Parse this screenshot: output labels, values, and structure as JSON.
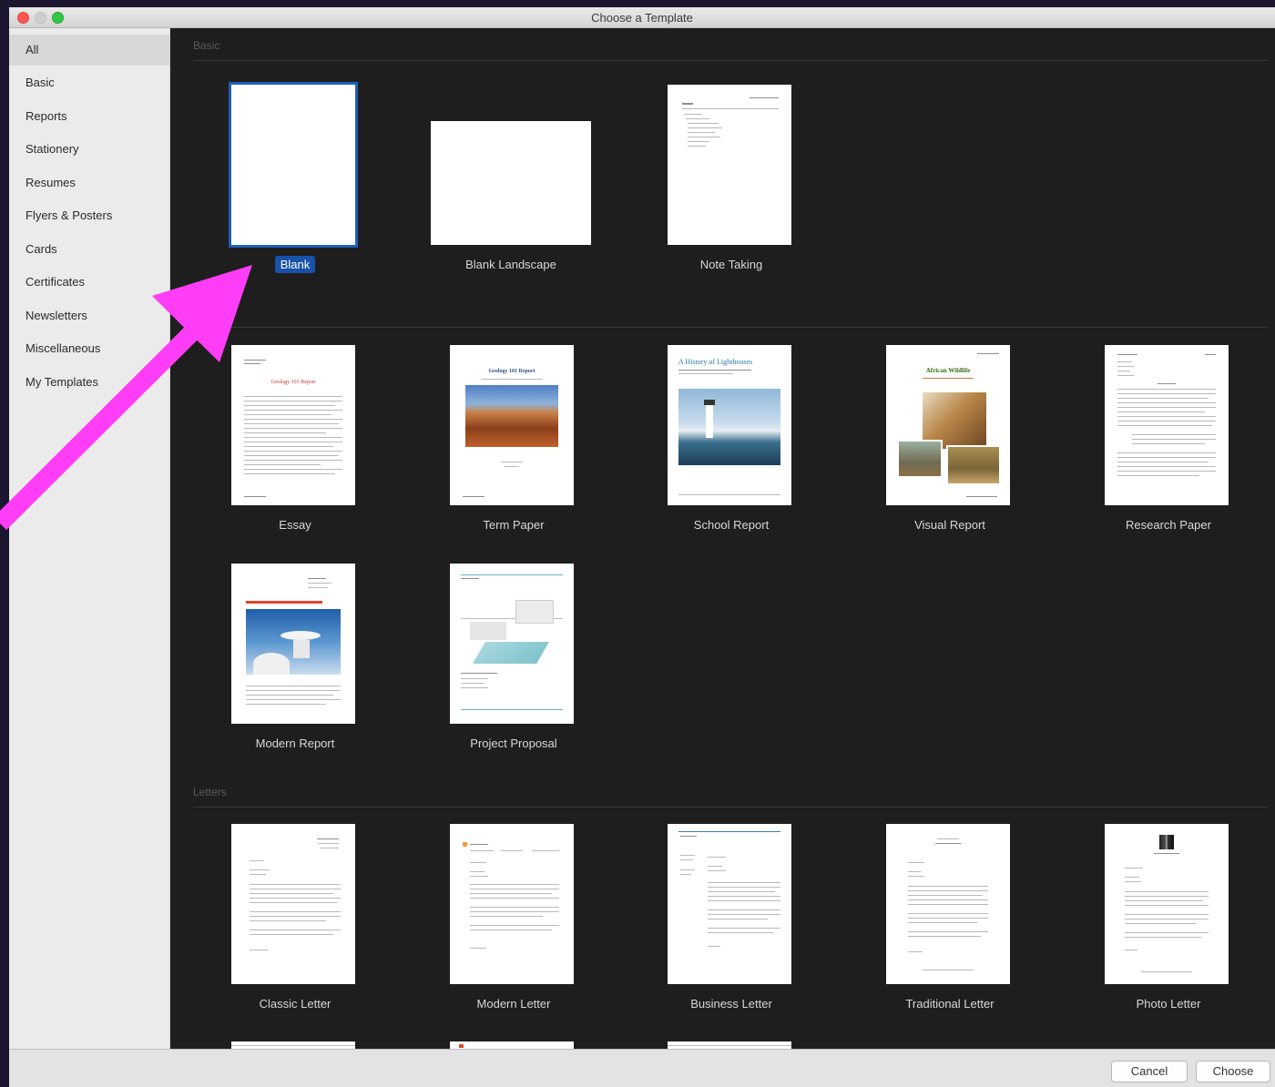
{
  "window": {
    "title": "Choose a Template"
  },
  "sidebar": {
    "items": [
      {
        "label": "All",
        "selected": true
      },
      {
        "label": "Basic"
      },
      {
        "label": "Reports"
      },
      {
        "label": "Stationery"
      },
      {
        "label": "Resumes"
      },
      {
        "label": "Flyers & Posters"
      },
      {
        "label": "Cards"
      },
      {
        "label": "Certificates"
      },
      {
        "label": "Newsletters"
      },
      {
        "label": "Miscellaneous"
      },
      {
        "label": "My Templates"
      }
    ]
  },
  "sections": {
    "basic": {
      "label": "Basic"
    },
    "letters": {
      "label": "Letters"
    }
  },
  "templates": {
    "blank": {
      "label": "Blank",
      "selected": true
    },
    "blank_landscape": {
      "label": "Blank Landscape"
    },
    "note_taking": {
      "label": "Note Taking"
    },
    "essay": {
      "label": "Essay",
      "heading": "Geology 101 Report"
    },
    "term_paper": {
      "label": "Term Paper",
      "heading": "Geology 101 Report"
    },
    "school_report": {
      "label": "School Report",
      "heading": "A History of Lighthouses"
    },
    "visual_report": {
      "label": "Visual Report",
      "heading": "African Wildlife"
    },
    "research_paper": {
      "label": "Research Paper"
    },
    "modern_report": {
      "label": "Modern Report"
    },
    "project_proposal": {
      "label": "Project Proposal"
    },
    "classic_letter": {
      "label": "Classic Letter"
    },
    "modern_letter": {
      "label": "Modern Letter"
    },
    "business_letter": {
      "label": "Business Letter"
    },
    "traditional_letter": {
      "label": "Traditional Letter"
    },
    "photo_letter": {
      "label": "Photo Letter"
    }
  },
  "buttons": {
    "cancel": "Cancel",
    "choose": "Choose"
  },
  "colors": {
    "annotation_arrow": "#ff3df6",
    "selection": "#1752a9"
  }
}
